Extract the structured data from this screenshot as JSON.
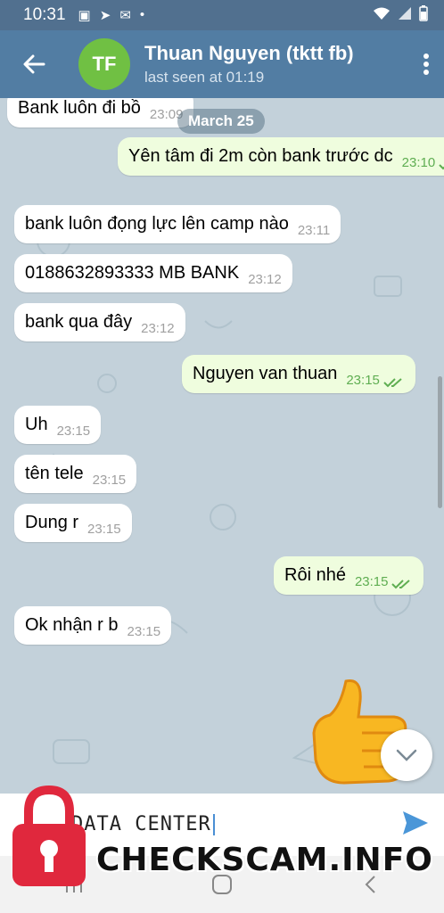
{
  "status_bar": {
    "time": "10:31"
  },
  "header": {
    "avatar_initials": "TF",
    "title": "Thuan Nguyen (tktt fb)",
    "subtitle": "last seen at 01:19",
    "avatar_color": "#70c043",
    "bar_color": "#527da3"
  },
  "chat": {
    "date_label": "March 25",
    "messages": [
      {
        "dir": "in",
        "text": "Bank luôn đi bồ",
        "time": "23:09"
      },
      {
        "dir": "out",
        "text": "Yên tâm đi 2m còn bank trước dc",
        "time": "23:10"
      },
      {
        "dir": "in",
        "text": "bank luôn đọng lực lên camp nào",
        "time": "23:11"
      },
      {
        "dir": "in",
        "text": "0188632893333 MB BANK",
        "time": "23:12"
      },
      {
        "dir": "in",
        "text": "bank qua đây",
        "time": "23:12"
      },
      {
        "dir": "out",
        "text": "Nguyen van thuan",
        "time": "23:15"
      },
      {
        "dir": "in",
        "text": "Uh",
        "time": "23:15"
      },
      {
        "dir": "in",
        "text": "tên tele",
        "time": "23:15"
      },
      {
        "dir": "in",
        "text": "Dung r",
        "time": "23:15"
      },
      {
        "dir": "out",
        "text": "Rôi nhé",
        "time": "23:15"
      },
      {
        "dir": "in",
        "text": "Ok nhận r b",
        "time": "23:15"
      }
    ]
  },
  "input": {
    "text": "DATA CENTER"
  },
  "watermark": {
    "text": "CHECKSCAM.INFO"
  },
  "colors": {
    "outgoing_bubble": "#effdde",
    "incoming_bubble": "#ffffff",
    "read_tick": "#5fae52"
  }
}
